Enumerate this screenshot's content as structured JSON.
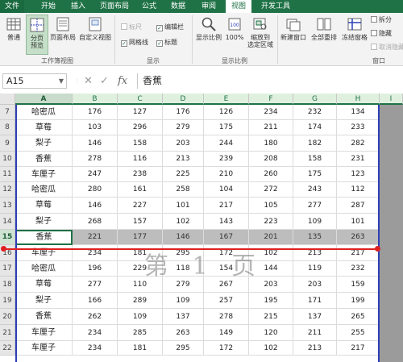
{
  "ribbon_tabs": [
    "文件",
    "开始",
    "插入",
    "页面布局",
    "公式",
    "数据",
    "审阅",
    "视图",
    "开发工具"
  ],
  "active_tab": "视图",
  "ribbon": {
    "workbook_views": {
      "label": "工作簿视图",
      "normal": "普通",
      "page_break_line1": "分页",
      "page_break_line2": "预览",
      "page_layout": "页面布局",
      "custom_views": "自定义视图"
    },
    "show": {
      "label": "显示",
      "ruler": "标尺",
      "edit_bar": "编辑栏",
      "gridlines": "网格线",
      "headings": "标题"
    },
    "zoom": {
      "label": "显示比例",
      "zoom": "显示比例",
      "zoom_100": "100%",
      "zoom_to_selection_line1": "缩放到",
      "zoom_to_selection_line2": "选定区域"
    },
    "window": {
      "label": "窗口",
      "new_window": "新建窗口",
      "arrange_all": "全部重排",
      "freeze_panes": "冻结窗格",
      "split": "拆分",
      "hide": "隐藏",
      "unhide": "取消隐藏"
    }
  },
  "formula_bar": {
    "name_box": "A15",
    "cancel_symbol": "✕",
    "enter_symbol": "✓",
    "fx_symbol": "fx",
    "content": "香蕉"
  },
  "columns": [
    "A",
    "B",
    "C",
    "D",
    "E",
    "F",
    "G",
    "H",
    "I"
  ],
  "selected_column": "A",
  "selected_row": "15",
  "rows": [
    {
      "num": "7",
      "name": "哈密瓜",
      "values": [
        "176",
        "127",
        "176",
        "126",
        "234",
        "232",
        "134"
      ]
    },
    {
      "num": "8",
      "name": "草莓",
      "values": [
        "103",
        "296",
        "279",
        "175",
        "211",
        "174",
        "233"
      ]
    },
    {
      "num": "9",
      "name": "梨子",
      "values": [
        "146",
        "158",
        "203",
        "244",
        "180",
        "182",
        "282"
      ]
    },
    {
      "num": "10",
      "name": "香蕉",
      "values": [
        "278",
        "116",
        "213",
        "239",
        "208",
        "158",
        "231"
      ]
    },
    {
      "num": "11",
      "name": "车厘子",
      "values": [
        "247",
        "238",
        "225",
        "210",
        "260",
        "175",
        "123"
      ]
    },
    {
      "num": "12",
      "name": "哈密瓜",
      "values": [
        "280",
        "161",
        "258",
        "104",
        "272",
        "243",
        "112"
      ]
    },
    {
      "num": "13",
      "name": "草莓",
      "values": [
        "146",
        "227",
        "101",
        "217",
        "105",
        "277",
        "287"
      ]
    },
    {
      "num": "14",
      "name": "梨子",
      "values": [
        "268",
        "157",
        "102",
        "143",
        "223",
        "109",
        "101"
      ]
    },
    {
      "num": "15",
      "name": "香蕉",
      "values": [
        "221",
        "177",
        "146",
        "167",
        "201",
        "135",
        "263"
      ]
    },
    {
      "num": "16",
      "name": "车厘子",
      "values": [
        "234",
        "181",
        "295",
        "172",
        "102",
        "213",
        "217"
      ]
    },
    {
      "num": "17",
      "name": "哈密瓜",
      "values": [
        "196",
        "229",
        "118",
        "154",
        "144",
        "119",
        "232"
      ]
    },
    {
      "num": "18",
      "name": "草莓",
      "values": [
        "277",
        "110",
        "279",
        "267",
        "203",
        "203",
        "159"
      ]
    },
    {
      "num": "19",
      "name": "梨子",
      "values": [
        "166",
        "289",
        "109",
        "257",
        "195",
        "171",
        "199"
      ]
    },
    {
      "num": "20",
      "name": "香蕉",
      "values": [
        "262",
        "109",
        "137",
        "278",
        "215",
        "137",
        "265"
      ]
    },
    {
      "num": "21",
      "name": "车厘子",
      "values": [
        "234",
        "285",
        "263",
        "149",
        "120",
        "211",
        "255"
      ]
    },
    {
      "num": "22",
      "name": "车厘子",
      "values": [
        "234",
        "181",
        "295",
        "172",
        "102",
        "213",
        "217"
      ]
    }
  ],
  "page_watermark": "第 1 页",
  "colors": {
    "excel_green": "#1f7246",
    "page_break_blue": "#2d3fb5",
    "annotation_red": "#e02020",
    "selected_row_grey": "#bdbdbd"
  },
  "icons": [
    "normal-view-icon",
    "page-break-preview-icon",
    "page-layout-icon",
    "custom-views-icon",
    "zoom-icon",
    "zoom-100-icon",
    "zoom-selection-icon",
    "new-window-icon",
    "arrange-all-icon",
    "freeze-panes-icon"
  ]
}
